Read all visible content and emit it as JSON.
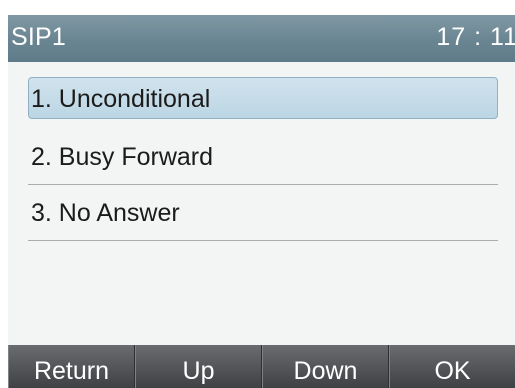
{
  "title_bar": {
    "account": "SIP1",
    "time": "17 : 11"
  },
  "menu": {
    "items": [
      {
        "label": "1. Unconditional",
        "selected": true
      },
      {
        "label": "2. Busy Forward",
        "selected": false
      },
      {
        "label": "3. No Answer",
        "selected": false
      }
    ]
  },
  "softkeys": [
    {
      "label": "Return"
    },
    {
      "label": "Up"
    },
    {
      "label": "Down"
    },
    {
      "label": "OK"
    }
  ],
  "colors": {
    "title_bar": "#6a8592",
    "selection": "#c4dbe8",
    "softkey_bar": "#4e5053"
  }
}
